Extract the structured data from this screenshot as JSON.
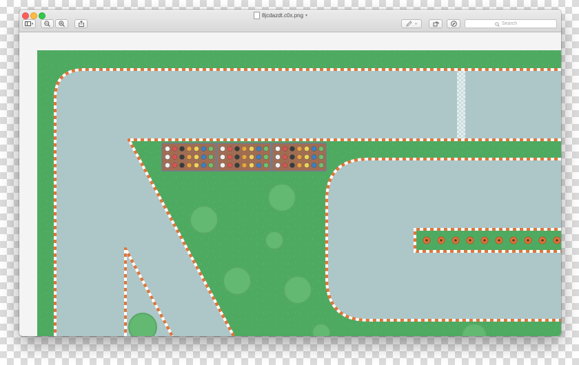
{
  "window": {
    "title": "8jcdazdt.c0x.png"
  },
  "toolbar": {
    "sidebar_icon": "sidebar-icon",
    "zoom_out_icon": "zoom-out-icon",
    "zoom_in_icon": "zoom-in-icon",
    "share_icon": "share-icon",
    "markup_icon": "pen-icon",
    "rotate_icon": "rotate-icon",
    "annotate_icon": "markup-circle-icon"
  },
  "search": {
    "placeholder": "Search",
    "icon": "magnifier-icon"
  },
  "colors": {
    "grass": "#4faa61",
    "track": "#adc7c8",
    "curb_orange": "#e0753a",
    "curb_white": "#ffffff",
    "bush": "#63b872",
    "stand": "#a16d52"
  }
}
